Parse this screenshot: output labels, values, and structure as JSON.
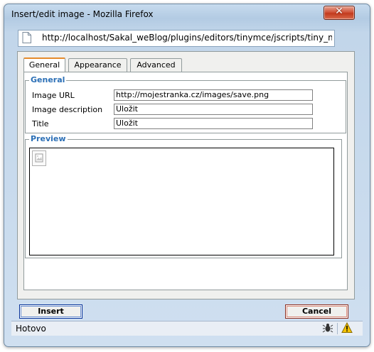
{
  "window": {
    "title": "Insert/edit image - Mozilla Firefox",
    "close_glyph": "✕"
  },
  "address": {
    "url": "http://localhost/Sakal_weBlog/plugins/editors/tinymce/jscripts/tiny_mce/plu"
  },
  "tabs": [
    {
      "label": "General",
      "active": true
    },
    {
      "label": "Appearance",
      "active": false
    },
    {
      "label": "Advanced",
      "active": false
    }
  ],
  "general": {
    "legend": "General",
    "fields": [
      {
        "label": "Image URL",
        "value": "http://mojestranka.cz/images/save.png"
      },
      {
        "label": "Image description",
        "value": "Uložit"
      },
      {
        "label": "Title",
        "value": "Uložit"
      }
    ]
  },
  "preview": {
    "legend": "Preview",
    "image_icon": "broken-image-icon"
  },
  "buttons": {
    "insert": "Insert",
    "cancel": "Cancel"
  },
  "status": {
    "text": "Hotovo",
    "icons": [
      "bug-icon",
      "warning-icon"
    ]
  },
  "colors": {
    "legend": "#2b6fb6",
    "active_tab": "#e68b2c",
    "insert_border": "#002d96",
    "cancel_border": "#8b2a1b"
  }
}
